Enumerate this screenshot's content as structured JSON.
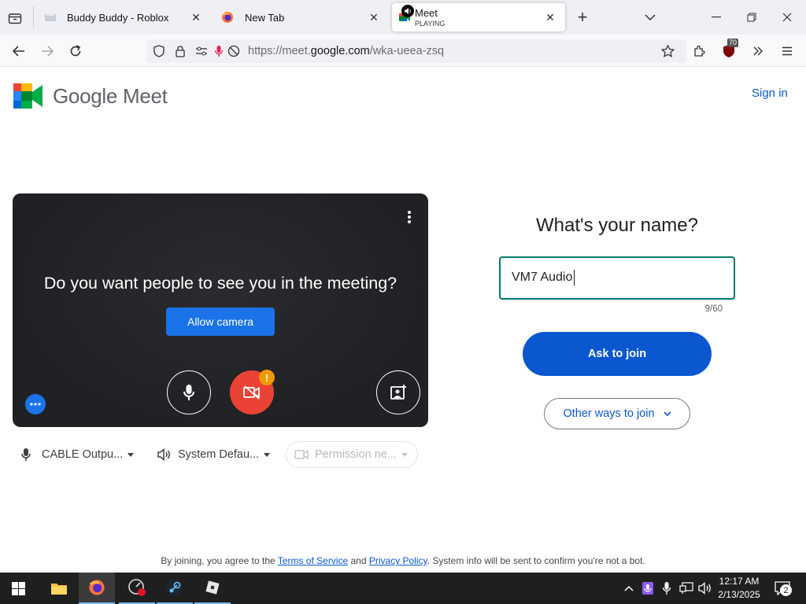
{
  "tabs": [
    {
      "title": "Buddy Buddy - Roblox"
    },
    {
      "title": "New Tab"
    },
    {
      "title": "Meet",
      "subtitle": "PLAYING"
    }
  ],
  "url": {
    "prefix": "https://meet.",
    "domain": "google.com",
    "path": "/wka-ueea-zsq"
  },
  "addon_badge": "70",
  "header": {
    "logo_text": "Google Meet",
    "sign_in": "Sign in"
  },
  "preview": {
    "question": "Do you want people to see you in the meeting?",
    "allow_camera": "Allow camera",
    "alert": "!"
  },
  "devices": {
    "mic": "CABLE Outpu...",
    "speaker": "System Defau...",
    "camera": "Permission ne..."
  },
  "join": {
    "heading": "What's your name?",
    "name_value": "VM7 Audio",
    "char_count": "9/60",
    "ask_button": "Ask to join",
    "other_ways": "Other ways to join"
  },
  "footer": {
    "pre": "By joining, you agree to the ",
    "tos": "Terms of Service",
    "and": " and ",
    "privacy": "Privacy Policy",
    "post": ". System info will be sent to confirm you're not a bot."
  },
  "taskbar": {
    "time": "12:17 AM",
    "date": "2/13/2025",
    "notif_count": "2"
  },
  "colors": {
    "accent": "#0b57d0",
    "input_border": "#00796b",
    "camera_off": "#ea4335",
    "alert": "#f29900"
  }
}
